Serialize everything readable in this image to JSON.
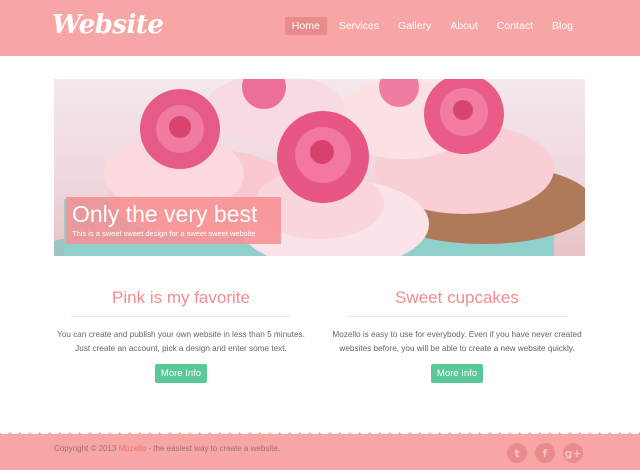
{
  "brand": {
    "logo": "Website"
  },
  "nav": {
    "items": [
      {
        "label": "Home",
        "active": true
      },
      {
        "label": "Services"
      },
      {
        "label": "Gallery"
      },
      {
        "label": "About"
      },
      {
        "label": "Contact"
      },
      {
        "label": "Blog"
      }
    ]
  },
  "hero": {
    "title": "Only the very best",
    "subtitle": "This is a sweet sweet design for a sweet sweet website"
  },
  "features": [
    {
      "title": "Pink is my favorite",
      "text": "You can create and publish your own website in less than 5 minutes. Just create an account, pick a design and enter some text.",
      "button": "More Info"
    },
    {
      "title": "Sweet cupcakes",
      "text": "Mozello is easy to use for everybody. Even if you have never created websites before, you will be able to create a new website quickly.",
      "button": "More Info"
    }
  ],
  "footer": {
    "copyright": "Copyright © 2013 ",
    "link": "Mozello",
    "tagline": " - the easiest way to create a website.",
    "social": [
      {
        "icon": "twitter-icon",
        "glyph": "t"
      },
      {
        "icon": "facebook-icon",
        "glyph": "f"
      },
      {
        "icon": "google-plus-icon",
        "glyph": "g+"
      }
    ]
  },
  "colors": {
    "header": "#f7a6a5",
    "accent": "#f08d91",
    "button": "#5bc89a"
  }
}
